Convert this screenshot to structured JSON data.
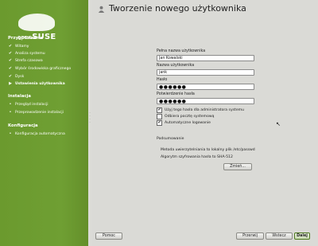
{
  "brand": {
    "logo_text": "open",
    "logo_text2": "SUSE"
  },
  "sidebar": {
    "sections": [
      {
        "title": "Przygotowanie"
      },
      {
        "title": "Instalacja"
      },
      {
        "title": "Konfiguracja"
      }
    ],
    "items": [
      {
        "label": "Witamy",
        "state": "done"
      },
      {
        "label": "Analiza systemu",
        "state": "done"
      },
      {
        "label": "Strefa czasowa",
        "state": "done"
      },
      {
        "label": "Wybór środowiska graficznego",
        "state": "done"
      },
      {
        "label": "Dysk",
        "state": "done"
      },
      {
        "label": "Ustawienia użytkownika",
        "state": "current"
      },
      {
        "label": "Przegląd instalacji",
        "state": "todo"
      },
      {
        "label": "Przeprowadzenie instalacji",
        "state": "todo"
      },
      {
        "label": "Konfiguracja automatyczna",
        "state": "todo"
      }
    ],
    "marks": {
      "done": "✔",
      "current": "▶",
      "todo": "•"
    }
  },
  "page": {
    "title": "Tworzenie nowego użytkownika"
  },
  "form": {
    "fullname_label": "Pełna nazwa użytkownika",
    "fullname_value": "Jan Kowalski",
    "username_label": "Nazwa użytkownika",
    "username_value": "jank",
    "password_label": "Hasło",
    "password_value": "●●●●●●",
    "confirm_label": "Potwierdzenie hasła",
    "confirm_value": "●●●●●●",
    "check_admin_label": "Użyj tego hasła dla administratora systemu",
    "check_mail_label": "Odbiera pocztę systemową",
    "check_autologin_label": "Automatyczne logowanie",
    "check_admin": true,
    "check_mail": false,
    "check_autologin": true
  },
  "summary": {
    "heading": "Podsumowanie",
    "auth_line": "Metoda uwierzytelniania to lokalny plik /etc/passwd",
    "algo_line": "Algorytm szyfrowania hasła to SHA-512",
    "change_button": "Zmień..."
  },
  "footer": {
    "help_button": "Pomoc",
    "abort_button": "Przerwij",
    "back_button": "Wstecz",
    "next_button": "Dalej"
  }
}
